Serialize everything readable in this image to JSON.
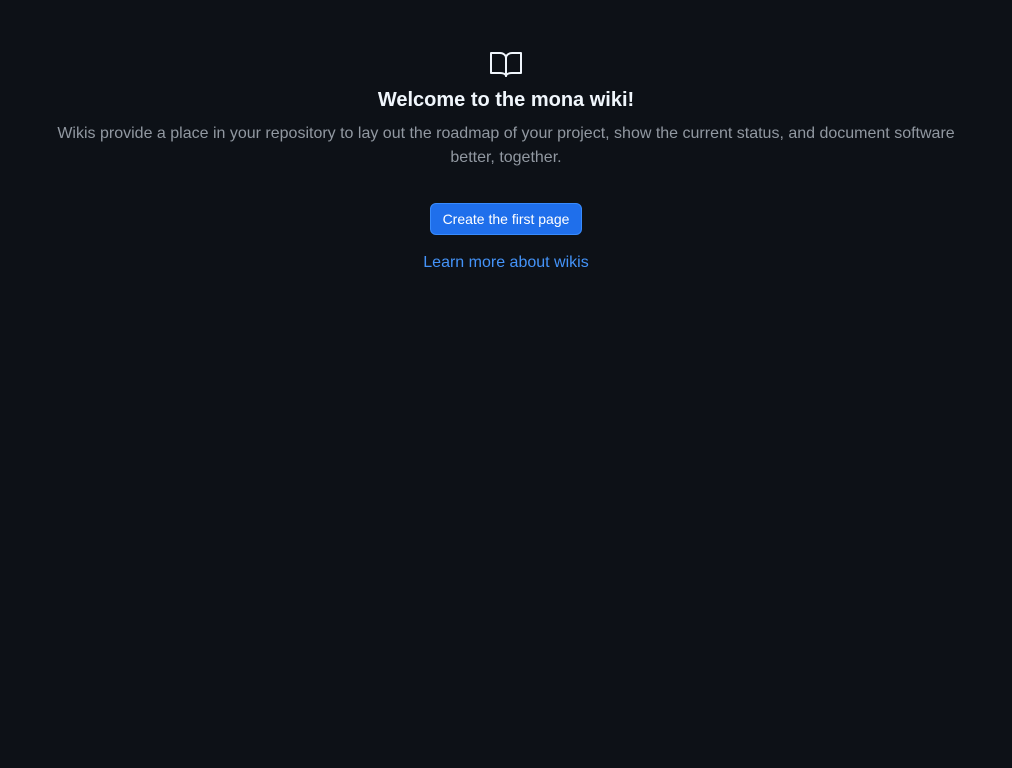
{
  "wiki": {
    "icon": "book-icon",
    "title": "Welcome to the mona wiki!",
    "description": "Wikis provide a place in your repository to lay out the roadmap of your project, show the current status, and document software better, together.",
    "create_button_label": "Create the first page",
    "learn_link_label": "Learn more about wikis"
  },
  "colors": {
    "background": "#0d1117",
    "title": "#f0f6fc",
    "muted_text": "#9198a1",
    "primary_button": "#1f6feb",
    "link": "#4493f8"
  }
}
